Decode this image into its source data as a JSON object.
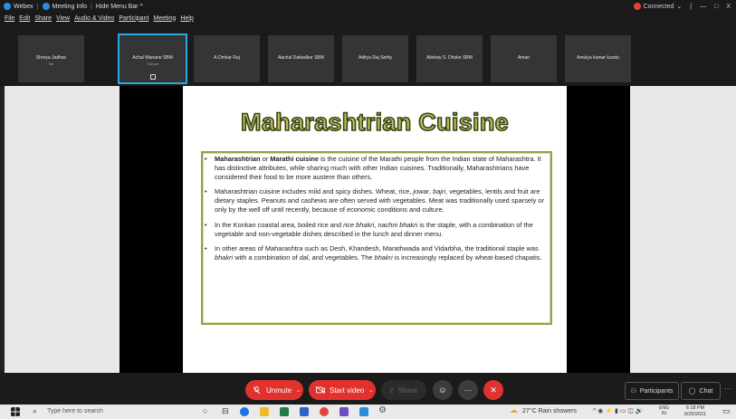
{
  "titlebar": {
    "app": "Webex",
    "meeting_info": "Meeting Info",
    "hide_menu": "Hide Menu Bar ^",
    "connected": "Connected",
    "minimize": "—",
    "maximize": "□",
    "close": "X"
  },
  "menu": [
    "File",
    "Edit",
    "Share",
    "View",
    "Audio & Video",
    "Participant",
    "Meeting",
    "Help"
  ],
  "participants": [
    {
      "name": "Shreya Jadhav",
      "sub": "Me"
    },
    {
      "name": "Achal Wanane SBM",
      "sub": "Cohost"
    },
    {
      "name": "A.Omkar Raj",
      "sub": ""
    },
    {
      "name": "Aachal Dalwalkar SBM",
      "sub": ""
    },
    {
      "name": "Aditya Raj Sethy",
      "sub": ""
    },
    {
      "name": "Akshay S. Dhoke SBM",
      "sub": ""
    },
    {
      "name": "Aman",
      "sub": ""
    },
    {
      "name": "Amulya kumar kundu",
      "sub": ""
    }
  ],
  "slide": {
    "title": "Maharashtrian Cuisine",
    "p1": {
      "b1": "Maharashtrian",
      "t1": " or ",
      "b2": "Marathi cuisine",
      "t2": " is the cuisine of the Marathi people from the Indian state of Maharashtra. It has distinctive attributes, while sharing much with other Indian cuisines. Traditionally, Maharashtrians have considered their food to be more austere than others."
    },
    "p2": {
      "t1": "Maharashtrian cuisine includes mild and spicy dishes. Wheat, rice, ",
      "i1": "jowar",
      "t2": ", ",
      "i2": "bajri",
      "t3": ", vegetables, lentils and fruit are dietary staples. Peanuts and cashews are often served with vegetables. Meat was traditionally used sparsely or only by the well off until recently, because of economic conditions and culture."
    },
    "p3": {
      "t1": "In the Konkan coastal area, boiled rice and ",
      "i1": "rice bhakri",
      "t2": ", ",
      "i2": "nachni bhakri",
      "t3": " is the staple, with a combination of the vegetable and non-vegetable dishes described in the lunch and dinner menu."
    },
    "p4": {
      "t1": "In other areas of Maharashtra such as Desh, Khandesh, Marathwada and Vidarbha, the traditional staple was ",
      "i1": "bhakri",
      "t2": " with a combination of ",
      "i2": "dal",
      "t3": ", and vegetables. The ",
      "i3": "bhakri",
      "t4": " is increasingly replaced by wheat-based chapatis."
    }
  },
  "controls": {
    "unmute": "Unmute",
    "start_video": "Start video",
    "share": "Share",
    "participants": "Participants",
    "chat": "Chat",
    "more": "···"
  },
  "taskbar": {
    "search_placeholder": "Type here to search",
    "weather": "27°C Rain showers",
    "lang1": "ENG",
    "lang2": "IN",
    "time": "6:18 PM",
    "date": "9/29/2021"
  },
  "colors": {
    "accent_blue": "#2aa7e0",
    "end_red": "#e1322e",
    "title_fill": "#c8ba55",
    "title_outline": "#35471a",
    "box_border": "#9aa048"
  }
}
